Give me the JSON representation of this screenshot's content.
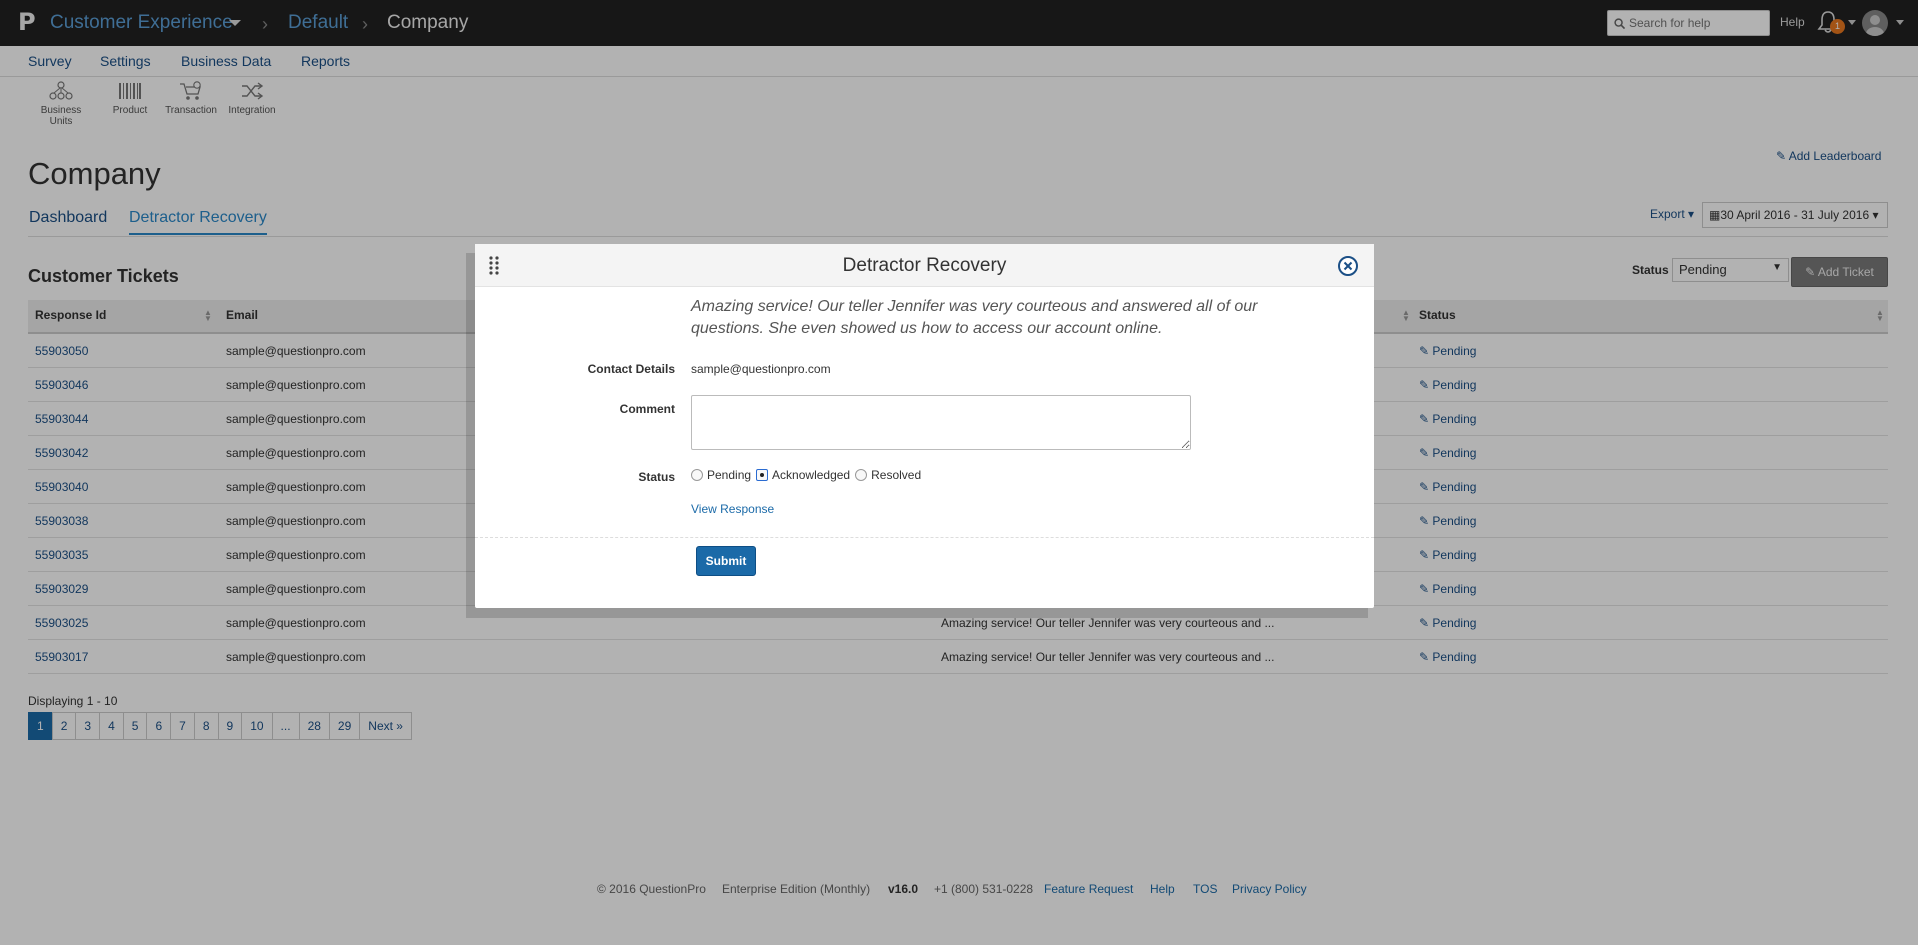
{
  "topbar": {
    "app_name": "Customer Experience",
    "breadcrumb_1": "Default",
    "breadcrumb_2": "Company",
    "search_placeholder": "Search for help",
    "help": "Help",
    "notification_count": "1"
  },
  "nav": {
    "items": [
      "Survey",
      "Settings",
      "Business Data",
      "Reports"
    ]
  },
  "subnav": {
    "items": [
      "Business Units",
      "Product",
      "Transaction",
      "Integration"
    ]
  },
  "page": {
    "title": "Company",
    "add_leaderboard": "Add Leaderboard",
    "tabs": [
      "Dashboard",
      "Detractor Recovery"
    ],
    "export": "Export",
    "date_range": "30 April 2016 - 31 July 2016"
  },
  "tickets": {
    "title": "Customer Tickets",
    "status_label": "Status",
    "status_value": "Pending",
    "add_ticket": "Add Ticket",
    "columns": [
      "Response Id",
      "Email",
      "Status"
    ],
    "rows": [
      {
        "id": "55903050",
        "email": "sample@questionpro.com",
        "comment": "",
        "status": "Pending"
      },
      {
        "id": "55903046",
        "email": "sample@questionpro.com",
        "comment": "",
        "status": "Pending"
      },
      {
        "id": "55903044",
        "email": "sample@questionpro.com",
        "comment": "",
        "status": "Pending"
      },
      {
        "id": "55903042",
        "email": "sample@questionpro.com",
        "comment": "",
        "status": "Pending"
      },
      {
        "id": "55903040",
        "email": "sample@questionpro.com",
        "comment": "",
        "status": "Pending"
      },
      {
        "id": "55903038",
        "email": "sample@questionpro.com",
        "comment": "",
        "status": "Pending"
      },
      {
        "id": "55903035",
        "email": "sample@questionpro.com",
        "comment": "",
        "status": "Pending"
      },
      {
        "id": "55903029",
        "email": "sample@questionpro.com",
        "comment": "",
        "status": "Pending"
      },
      {
        "id": "55903025",
        "email": "sample@questionpro.com",
        "comment": "Amazing service! Our teller Jennifer was very courteous and ...",
        "status": "Pending"
      },
      {
        "id": "55903017",
        "email": "sample@questionpro.com",
        "comment": "Amazing service! Our teller Jennifer was very courteous and ...",
        "status": "Pending"
      }
    ],
    "displaying": "Displaying 1 - 10",
    "pages": [
      "1",
      "2",
      "3",
      "4",
      "5",
      "6",
      "7",
      "8",
      "9",
      "10",
      "...",
      "28",
      "29",
      "Next »"
    ]
  },
  "footer": {
    "copyright": "© 2016 QuestionPro",
    "edition": "Enterprise Edition (Monthly)",
    "version": "v16.0",
    "phone": "+1 (800) 531-0228",
    "feature_request": "Feature Request",
    "help": "Help",
    "tos": "TOS",
    "privacy": "Privacy Policy"
  },
  "modal": {
    "title": "Detractor Recovery",
    "quote": "Amazing service! Our teller Jennifer was very courteous and answered all of our questions. She even showed us how to access our account online.",
    "contact_label": "Contact Details",
    "contact_value": "sample@questionpro.com",
    "comment_label": "Comment",
    "comment_value": "",
    "status_label": "Status",
    "status_options": [
      "Pending",
      "Acknowledged",
      "Resolved"
    ],
    "status_selected": "Acknowledged",
    "view_response": "View Response",
    "submit": "Submit"
  }
}
